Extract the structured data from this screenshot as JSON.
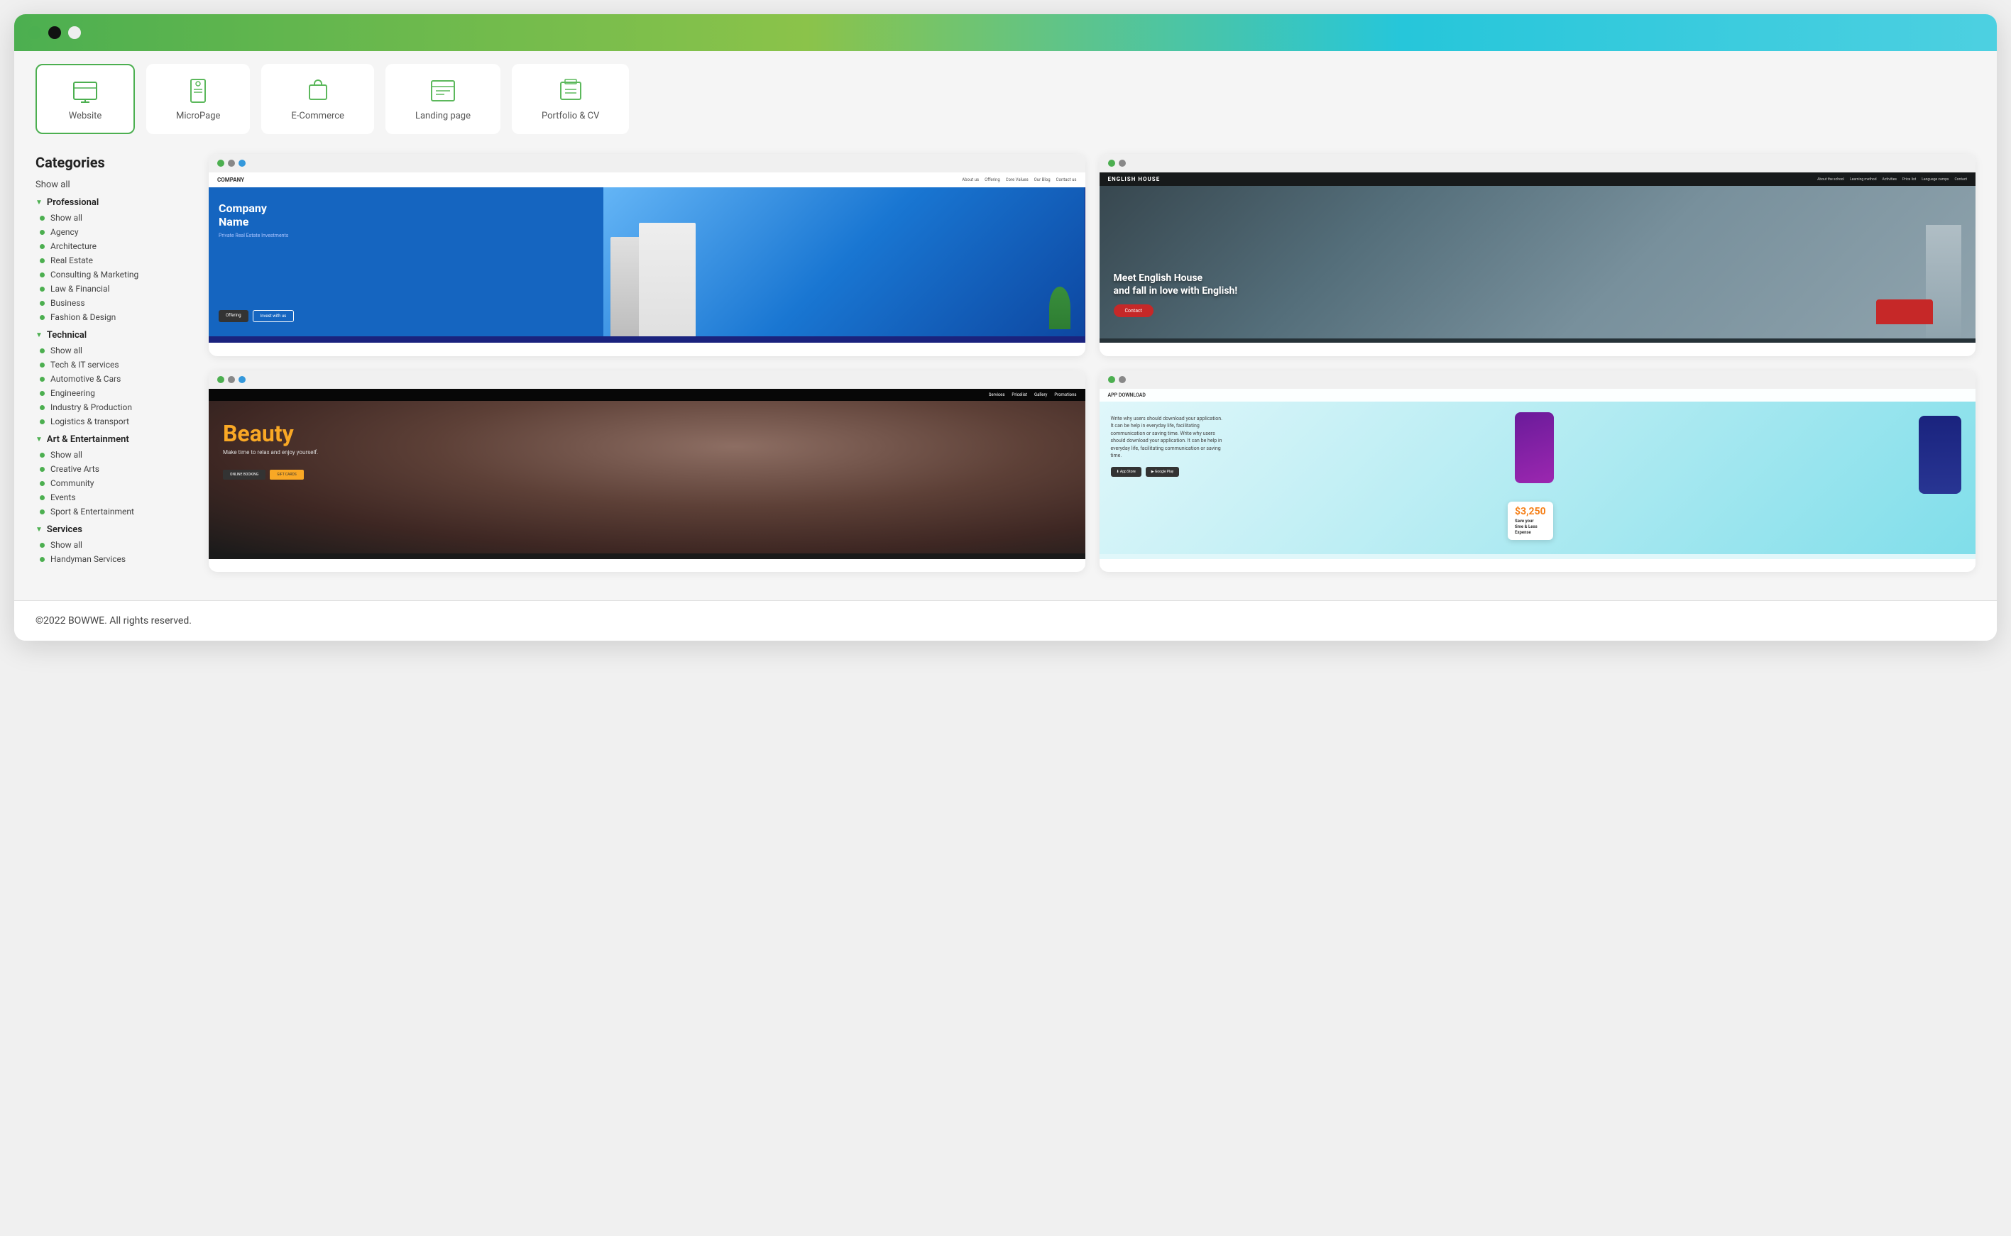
{
  "browser": {
    "dots": [
      {
        "color": "#4CAF50"
      },
      {
        "color": "#111111"
      },
      {
        "color": "#eeeeee"
      }
    ]
  },
  "tabs": [
    {
      "label": "Website",
      "active": true
    },
    {
      "label": "MicroPage",
      "active": false
    },
    {
      "label": "E-Commerce",
      "active": false
    },
    {
      "label": "Landing page",
      "active": false
    },
    {
      "label": "Portfolio & CV",
      "active": false
    }
  ],
  "sidebar": {
    "title": "Categories",
    "show_all": "Show all",
    "sections": [
      {
        "name": "Professional",
        "expanded": true,
        "items": [
          "Show all",
          "Agency",
          "Architecture",
          "Real Estate",
          "Consulting & Marketing",
          "Law & Financial",
          "Business",
          "Fashion & Design"
        ]
      },
      {
        "name": "Technical",
        "expanded": true,
        "items": [
          "Show all",
          "Tech & IT services",
          "Automotive & Cars",
          "Engineering",
          "Industry & Production",
          "Logistics & transport"
        ]
      },
      {
        "name": "Art & Entertainment",
        "expanded": true,
        "items": [
          "Show all",
          "Creative Arts",
          "Community",
          "Events",
          "Sport & Entertainment"
        ]
      },
      {
        "name": "Services",
        "expanded": true,
        "items": [
          "Show all",
          "Handyman Services"
        ]
      }
    ]
  },
  "templates": [
    {
      "id": "company",
      "dots": [
        "#4CAF50",
        "#888",
        "#ddd"
      ],
      "nav_logo": "COMPANY",
      "nav_links": [
        "About us",
        "Offering",
        "Core Values",
        "Our Blog",
        "Contact us"
      ],
      "title": "Company Name",
      "subtitle": "Private Real Estate Investments",
      "btn1": "Offering",
      "btn2": "Invest with us"
    },
    {
      "id": "english-house",
      "dots": [
        "#4CAF50",
        "#888"
      ],
      "nav_logo": "ENGLISH HOUSE",
      "nav_links": [
        "About the school",
        "Learning method",
        "Activities",
        "Price list",
        "Language camps",
        "Contact"
      ],
      "headline": "Meet English House\nand fall in love with English!",
      "cta": "Contact"
    },
    {
      "id": "beauty",
      "dots": [
        "#4CAF50",
        "#888",
        "#3498db"
      ],
      "nav_links": [
        "Services",
        "Pricelist",
        "Gallery",
        "Promotions"
      ],
      "title": "Beauty",
      "subtitle": "Make time to relax and enjoy yourself.",
      "btn1": "ONLINE BOOKING",
      "btn2": "GIFT CARDS"
    },
    {
      "id": "app",
      "dots": [
        "#4CAF50",
        "#888"
      ],
      "nav_label": "APP DOWNLOAD",
      "description": "Write why users should download your application. It can be help in everyday life, facilitating communication or saving time.",
      "store1": "Download on the App Store",
      "store2": "GET IT ON Google Play",
      "amount": "$3,250",
      "save_title": "Save your\ntime & Less\nExpense"
    }
  ],
  "footer": {
    "text": "©2022 BOWWE. All rights reserved."
  }
}
